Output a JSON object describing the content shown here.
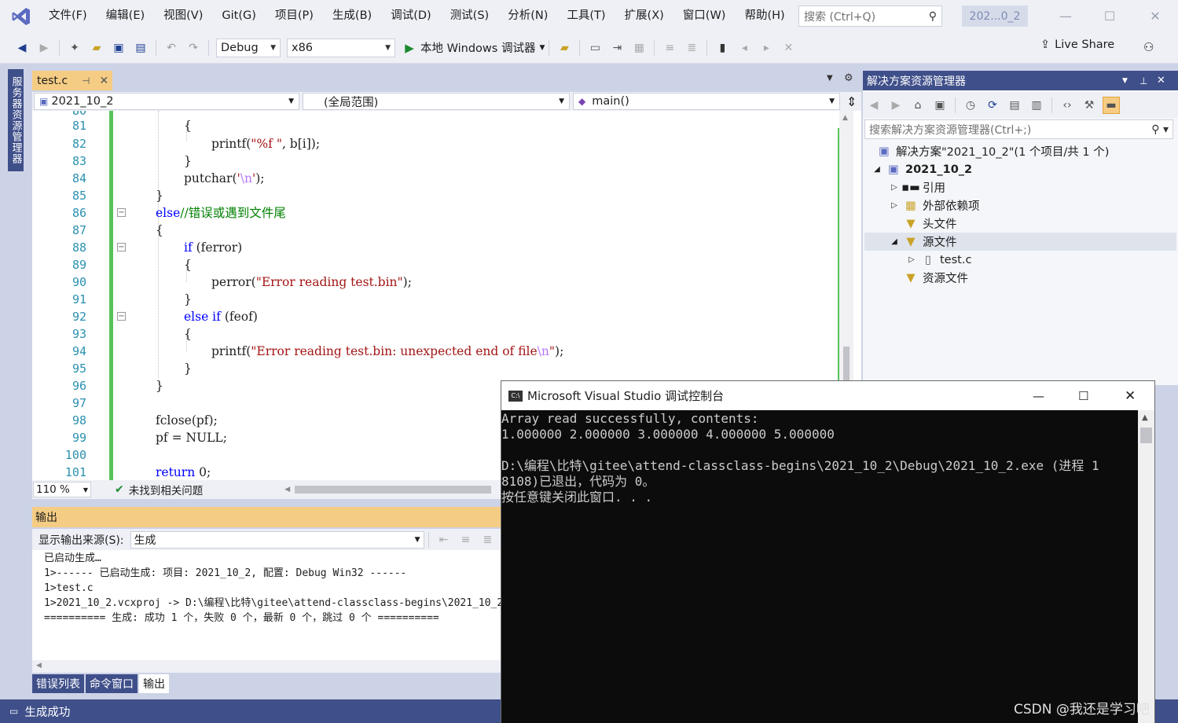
{
  "menu": [
    "文件(F)",
    "编辑(E)",
    "视图(V)",
    "Git(G)",
    "项目(P)",
    "生成(B)",
    "调试(D)",
    "测试(S)",
    "分析(N)",
    "工具(T)",
    "扩展(X)",
    "窗口(W)",
    "帮助(H)"
  ],
  "search": {
    "placeholder": "搜索 (Ctrl+Q)"
  },
  "title_badge": "202...0_2",
  "toolbar": {
    "config": "Debug",
    "platform": "x86",
    "run_label": "本地 Windows 调试器",
    "live_share": "Live Share"
  },
  "left_tab": "服务器资源管理器",
  "doc_tab": {
    "name": "test.c"
  },
  "nav": {
    "project": "2021_10_2",
    "scope": "(全局范围)",
    "member": "main()"
  },
  "code_lines": [
    {
      "n": "80",
      "text": ""
    },
    {
      "n": "81",
      "text": "{"
    },
    {
      "n": "82",
      "text": "printf"
    },
    {
      "n": "83",
      "text": "}"
    },
    {
      "n": "84",
      "text": "putchar"
    },
    {
      "n": "85",
      "text": "}"
    },
    {
      "n": "86",
      "text": "else"
    },
    {
      "n": "87",
      "text": "{"
    },
    {
      "n": "88",
      "text": "if"
    },
    {
      "n": "89",
      "text": "{"
    },
    {
      "n": "90",
      "text": "perror"
    },
    {
      "n": "91",
      "text": "}"
    },
    {
      "n": "92",
      "text": "else if"
    },
    {
      "n": "93",
      "text": "{"
    },
    {
      "n": "94",
      "text": "printf"
    },
    {
      "n": "95",
      "text": "}"
    },
    {
      "n": "96",
      "text": "}"
    },
    {
      "n": "97",
      "text": ""
    },
    {
      "n": "98",
      "text": "fclose"
    },
    {
      "n": "99",
      "text": "pf"
    },
    {
      "n": "100",
      "text": ""
    },
    {
      "n": "101",
      "text": "return"
    }
  ],
  "code": {
    "l82a": "printf(",
    "l82s": "\"%f \"",
    "l82b": ", b[i]);",
    "l84a": "putchar(",
    "l84s": "'",
    "l84e": "\\n",
    "l84s2": "'",
    "l84b": ");",
    "l86k": "else",
    "l86c": "//错误或遇到文件尾",
    "l88k": "if",
    "l88b": " (ferror)",
    "l90a": "perror(",
    "l90s": "\"Error reading test.bin\"",
    "l90b": ");",
    "l92k": "else if",
    "l92b": " (feof)",
    "l94a": "printf(",
    "l94s": "\"Error reading test.bin: unexpected end of file",
    "l94e": "\\n",
    "l94s2": "\"",
    "l94b": ");",
    "l98": "fclose(pf);",
    "l99": "pf = NULL;",
    "l101k": "return",
    "l101b": " 0;",
    "open": "{",
    "close": "}"
  },
  "editor_status": {
    "zoom": "110 %",
    "issues": "未找到相关问题"
  },
  "output": {
    "title": "输出",
    "source_label": "显示输出来源(S):",
    "source_value": "生成",
    "lines": [
      "已启动生成…",
      "1>------ 已启动生成: 项目: 2021_10_2, 配置: Debug Win32 ------",
      "1>test.c",
      "1>2021_10_2.vcxproj -> D:\\编程\\比特\\gitee\\attend-classclass-begins\\2021_10_2",
      "========== 生成: 成功 1 个，失败 0 个，最新 0 个，跳过 0 个 =========="
    ]
  },
  "bottom_tabs": [
    "错误列表",
    "命令窗口",
    "输出"
  ],
  "status": {
    "text": "生成成功"
  },
  "solution": {
    "title": "解决方案资源管理器",
    "search_placeholder": "搜索解决方案资源管理器(Ctrl+;)",
    "items": [
      {
        "label": "解决方案\"2021_10_2\"(1 个项目/共 1 个)"
      },
      {
        "label": "2021_10_2"
      },
      {
        "label": "引用"
      },
      {
        "label": "外部依赖项"
      },
      {
        "label": "头文件"
      },
      {
        "label": "源文件"
      },
      {
        "label": "test.c"
      },
      {
        "label": "资源文件"
      }
    ]
  },
  "console": {
    "title": "Microsoft Visual Studio 调试控制台",
    "lines": [
      "Array read successfully, contents:",
      "1.000000 2.000000 3.000000 4.000000 5.000000",
      "",
      "D:\\编程\\比特\\gitee\\attend-classclass-begins\\2021_10_2\\Debug\\2021_10_2.exe (进程 1",
      "8108)已退出，代码为 0。",
      "按任意键关闭此窗口. . ."
    ]
  },
  "watermark": "CSDN @我还是学习吧",
  "colors": {
    "accent": "#3f4f8a",
    "active_tab": "#f5cc84",
    "line_number": "#2b91af",
    "keyword": "#0000ff",
    "string": "#a31515",
    "comment": "#008000",
    "change_bar": "#57c35a",
    "console_bg": "#0c0c0c"
  }
}
